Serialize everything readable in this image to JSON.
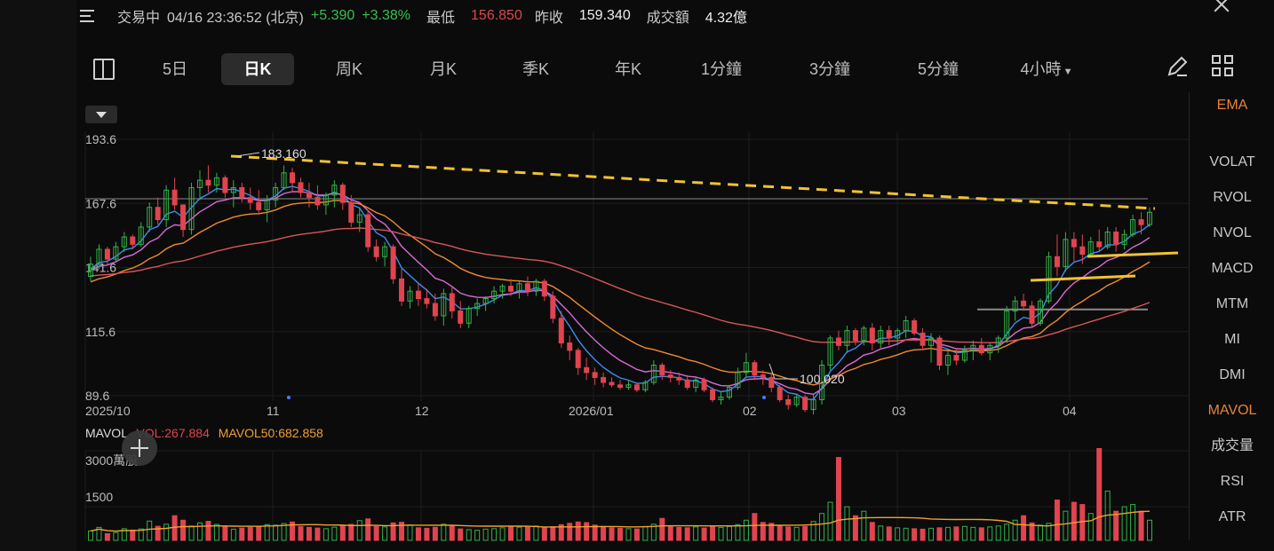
{
  "header": {
    "status": "交易中",
    "datetime": "04/16 23:36:52 (北京)",
    "change": "+5.390",
    "change_pct": "+3.38%",
    "low_label": "最低",
    "low_value": "156.850",
    "prev_close_label": "昨收",
    "prev_close_value": "159.340",
    "turnover_label": "成交額",
    "turnover_value": "4.32億"
  },
  "tabs": [
    "5日",
    "日K",
    "周K",
    "月K",
    "季K",
    "年K",
    "1分鐘",
    "3分鐘",
    "5分鐘",
    "4小時"
  ],
  "active_tab": "日K",
  "indicators": [
    "EMA",
    "VOLAT",
    "RVOL",
    "NVOL",
    "MACD",
    "MTM",
    "MI",
    "DMI",
    "MAVOL",
    "成交量",
    "RSI",
    "ATR"
  ],
  "active_indicators": [
    "EMA",
    "MAVOL"
  ],
  "colors": {
    "up": "#33b24a",
    "down": "#e0444f",
    "ema1": "#3d8cf0",
    "ema2": "#d86ad8",
    "ema3": "#f08a30",
    "ema4": "#d8555e",
    "trendline": "#f1c232",
    "mavol": "#f0a030"
  },
  "mavol": {
    "name": "MAVOL",
    "vol": "VOL:267.884",
    "mavol50": "MAVOL50:682.858"
  },
  "chart_data": {
    "type": "candlestick",
    "y_ticks": [
      "193.6",
      "167.6",
      "141.6",
      "115.6",
      "89.6"
    ],
    "x_ticks": [
      "2025/10",
      "11",
      "12",
      "2026/01",
      "02",
      "03",
      "04"
    ],
    "ylim": [
      89.6,
      193.6
    ],
    "high_annotation": "183.160",
    "low_annotation": "100.020",
    "reference_lines": [
      169.5,
      124.6
    ],
    "volume_ticks": [
      "3000萬股",
      "1500"
    ],
    "volume_ylim": [
      0,
      4000
    ],
    "series_ohlc_daily": [
      [
        138,
        146,
        136,
        143
      ],
      [
        143,
        151,
        141,
        149
      ],
      [
        149,
        150,
        143,
        145
      ],
      [
        145,
        152,
        144,
        150
      ],
      [
        150,
        156,
        148,
        154
      ],
      [
        154,
        155,
        149,
        151
      ],
      [
        151,
        160,
        150,
        158
      ],
      [
        158,
        168,
        156,
        166
      ],
      [
        166,
        170,
        159,
        161
      ],
      [
        161,
        175,
        158,
        173
      ],
      [
        173,
        178,
        165,
        167
      ],
      [
        167,
        167,
        154,
        157
      ],
      [
        157,
        176,
        155,
        174
      ],
      [
        174,
        181,
        169,
        177
      ],
      [
        177,
        183,
        172,
        175
      ],
      [
        175,
        180,
        172,
        178
      ],
      [
        178,
        179,
        170,
        172
      ],
      [
        172,
        177,
        166,
        174
      ],
      [
        174,
        176,
        168,
        170
      ],
      [
        170,
        174,
        165,
        168
      ],
      [
        168,
        173,
        163,
        165
      ],
      [
        165,
        171,
        160,
        169
      ],
      [
        169,
        176,
        166,
        174
      ],
      [
        174,
        183,
        173,
        180
      ],
      [
        180,
        182,
        172,
        176
      ],
      [
        176,
        178,
        170,
        172
      ],
      [
        172,
        176,
        166,
        170
      ],
      [
        170,
        175,
        165,
        167
      ],
      [
        167,
        172,
        163,
        171
      ],
      [
        171,
        177,
        166,
        175
      ],
      [
        175,
        176,
        165,
        168
      ],
      [
        168,
        171,
        158,
        160
      ],
      [
        160,
        166,
        156,
        163
      ],
      [
        163,
        165,
        148,
        150
      ],
      [
        150,
        153,
        144,
        146
      ],
      [
        146,
        152,
        142,
        150
      ],
      [
        150,
        151,
        135,
        137
      ],
      [
        137,
        141,
        126,
        128
      ],
      [
        128,
        134,
        125,
        132
      ],
      [
        132,
        135,
        126,
        129
      ],
      [
        129,
        133,
        125,
        127
      ],
      [
        127,
        131,
        120,
        122
      ],
      [
        122,
        133,
        118,
        131
      ],
      [
        131,
        134,
        121,
        124
      ],
      [
        124,
        128,
        117,
        119
      ],
      [
        119,
        126,
        117,
        125
      ],
      [
        125,
        129,
        122,
        127
      ],
      [
        127,
        130,
        124,
        129
      ],
      [
        129,
        134,
        127,
        132
      ],
      [
        132,
        135,
        129,
        134
      ],
      [
        134,
        137,
        130,
        132
      ],
      [
        132,
        136,
        129,
        135
      ],
      [
        135,
        138,
        130,
        132
      ],
      [
        132,
        137,
        130,
        136
      ],
      [
        136,
        137,
        128,
        130
      ],
      [
        130,
        132,
        119,
        121
      ],
      [
        121,
        124,
        109,
        111
      ],
      [
        111,
        114,
        104,
        108
      ],
      [
        108,
        109,
        98,
        101
      ],
      [
        101,
        105,
        96,
        99
      ],
      [
        99,
        101,
        94,
        97
      ],
      [
        97,
        99,
        93,
        95
      ],
      [
        95,
        97,
        93,
        94
      ],
      [
        94,
        96,
        92,
        93
      ],
      [
        93,
        96,
        92,
        94
      ],
      [
        94,
        95,
        91,
        92
      ],
      [
        92,
        96,
        91,
        95
      ],
      [
        95,
        104,
        94,
        102
      ],
      [
        102,
        103,
        96,
        98
      ],
      [
        98,
        100,
        95,
        97
      ],
      [
        97,
        99,
        94,
        96
      ],
      [
        96,
        98,
        92,
        93
      ],
      [
        93,
        97,
        91,
        96
      ],
      [
        96,
        97,
        91,
        92
      ],
      [
        92,
        93,
        87,
        88
      ],
      [
        88,
        91,
        86,
        89
      ],
      [
        89,
        94,
        88,
        93
      ],
      [
        93,
        101,
        92,
        99
      ],
      [
        99,
        107,
        97,
        103
      ],
      [
        103,
        104,
        96,
        98
      ],
      [
        98,
        100,
        94,
        97
      ],
      [
        97,
        99,
        91,
        93
      ],
      [
        93,
        94,
        87,
        88
      ],
      [
        88,
        90,
        84,
        86
      ],
      [
        86,
        90,
        85,
        89
      ],
      [
        89,
        90,
        83,
        84
      ],
      [
        84,
        90,
        82,
        88
      ],
      [
        88,
        104,
        86,
        102
      ],
      [
        102,
        114,
        100,
        113
      ],
      [
        113,
        116,
        108,
        110
      ],
      [
        110,
        118,
        107,
        116
      ],
      [
        116,
        117,
        110,
        112
      ],
      [
        112,
        118,
        110,
        117
      ],
      [
        117,
        119,
        108,
        111
      ],
      [
        111,
        118,
        109,
        116
      ],
      [
        116,
        118,
        110,
        113
      ],
      [
        113,
        117,
        110,
        116
      ],
      [
        116,
        122,
        113,
        120
      ],
      [
        120,
        121,
        114,
        115
      ],
      [
        115,
        117,
        108,
        110
      ],
      [
        110,
        115,
        103,
        113
      ],
      [
        113,
        114,
        100,
        102
      ],
      [
        102,
        108,
        98,
        106
      ],
      [
        106,
        109,
        102,
        104
      ],
      [
        104,
        110,
        103,
        108
      ],
      [
        108,
        112,
        104,
        110
      ],
      [
        110,
        113,
        106,
        107
      ],
      [
        107,
        111,
        104,
        110
      ],
      [
        110,
        114,
        107,
        113
      ],
      [
        113,
        126,
        111,
        124
      ],
      [
        124,
        130,
        120,
        128
      ],
      [
        128,
        131,
        124,
        126
      ],
      [
        126,
        128,
        117,
        119
      ],
      [
        119,
        129,
        118,
        128
      ],
      [
        128,
        148,
        127,
        146
      ],
      [
        146,
        155,
        138,
        142
      ],
      [
        142,
        156,
        140,
        153
      ],
      [
        153,
        156,
        144,
        150
      ],
      [
        150,
        155,
        143,
        147
      ],
      [
        147,
        154,
        146,
        152
      ],
      [
        152,
        157,
        148,
        150
      ],
      [
        150,
        158,
        149,
        156
      ],
      [
        156,
        158,
        148,
        151
      ],
      [
        151,
        157,
        149,
        155
      ],
      [
        155,
        163,
        154,
        161
      ],
      [
        161,
        164,
        155,
        159
      ],
      [
        159,
        166,
        158,
        164
      ]
    ],
    "volume_values": [
      420,
      580,
      300,
      350,
      520,
      460,
      510,
      860,
      630,
      720,
      1100,
      900,
      640,
      780,
      850,
      710,
      600,
      500,
      550,
      580,
      620,
      700,
      680,
      750,
      820,
      610,
      580,
      550,
      520,
      590,
      640,
      710,
      880,
      960,
      620,
      600,
      780,
      810,
      690,
      560,
      540,
      580,
      720,
      640,
      510,
      480,
      450,
      500,
      520,
      560,
      600,
      590,
      620,
      640,
      580,
      610,
      700,
      760,
      820,
      790,
      680,
      620,
      560,
      540,
      520,
      510,
      600,
      720,
      980,
      640,
      580,
      560,
      600,
      550,
      610,
      580,
      620,
      700,
      900,
      1200,
      800,
      760,
      640,
      600,
      580,
      620,
      840,
      1200,
      1700,
      3700,
      1500,
      1100,
      1300,
      800,
      640,
      600,
      560,
      540,
      520,
      500,
      540,
      560,
      580,
      600,
      620,
      580,
      560,
      600,
      640,
      720,
      900,
      1100,
      780,
      680,
      760,
      1800,
      1300,
      1700,
      1600,
      1200,
      4100,
      2200,
      1300,
      1500,
      1600,
      1300,
      900,
      1100,
      800,
      780,
      740,
      900,
      650,
      560,
      267
    ]
  }
}
